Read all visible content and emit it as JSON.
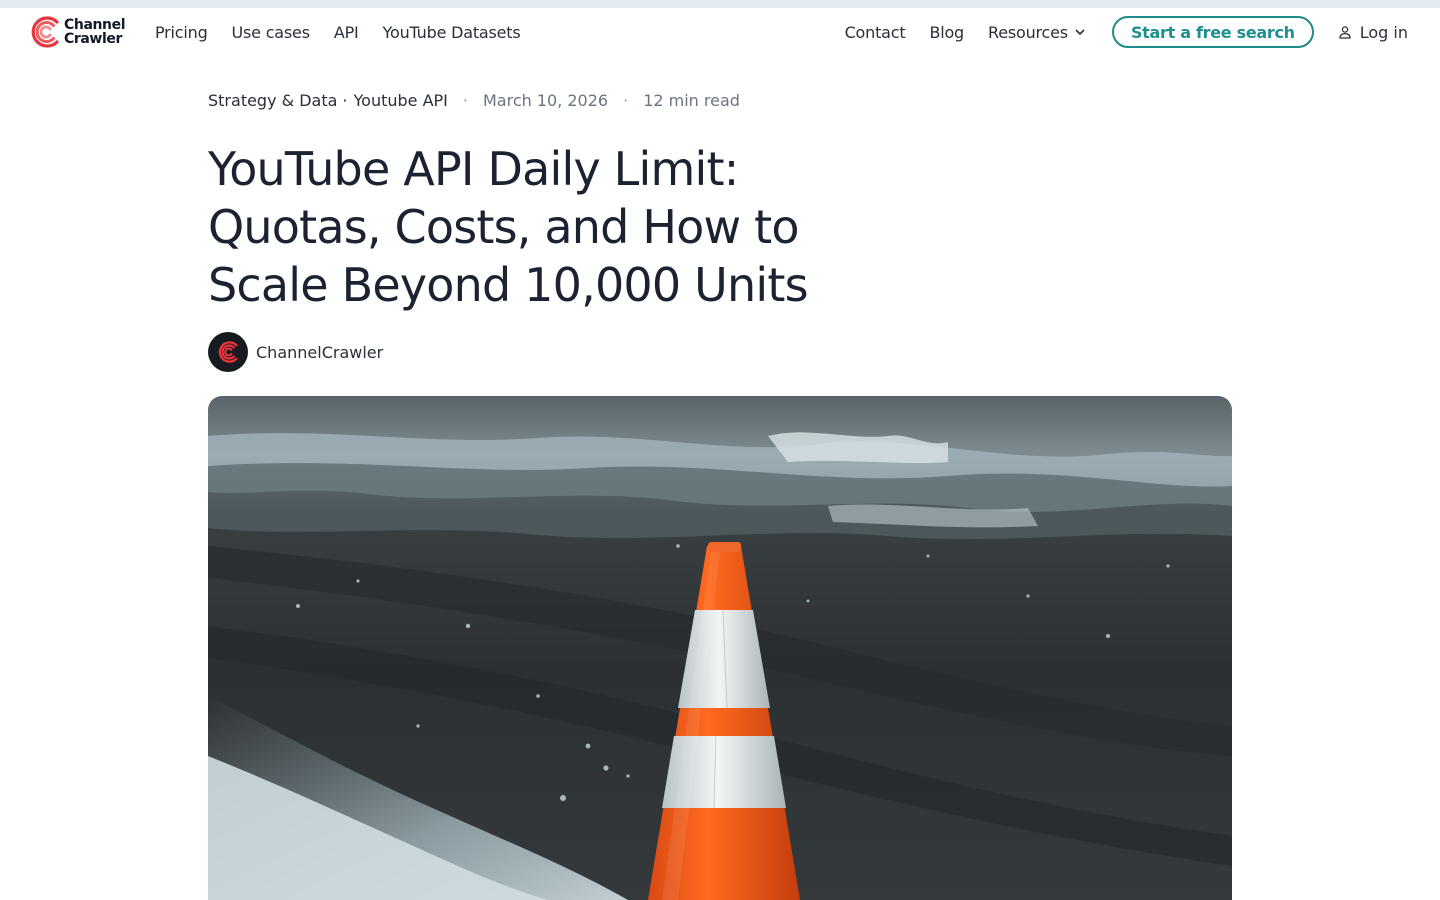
{
  "brand": {
    "line1": "Channel",
    "line2": "Crawler",
    "logo_icon": "channelcrawler-arc-logo",
    "accent_red": "#e8343a",
    "accent_teal": "#1f8a8a"
  },
  "nav": {
    "left": [
      "Pricing",
      "Use cases",
      "API",
      "YouTube Datasets"
    ],
    "right": {
      "contact": "Contact",
      "blog": "Blog",
      "resources": "Resources",
      "cta": "Start a free search",
      "login": "Log in"
    }
  },
  "article": {
    "category1": "Strategy & Data",
    "category2": "Youtube API",
    "date": "March 10, 2026",
    "read_time": "12 min read",
    "title_lines": [
      "YouTube API Daily Limit:",
      "Quotas, Costs, and How to",
      "Scale Beyond 10,000 Units"
    ],
    "author": "ChannelCrawler"
  }
}
